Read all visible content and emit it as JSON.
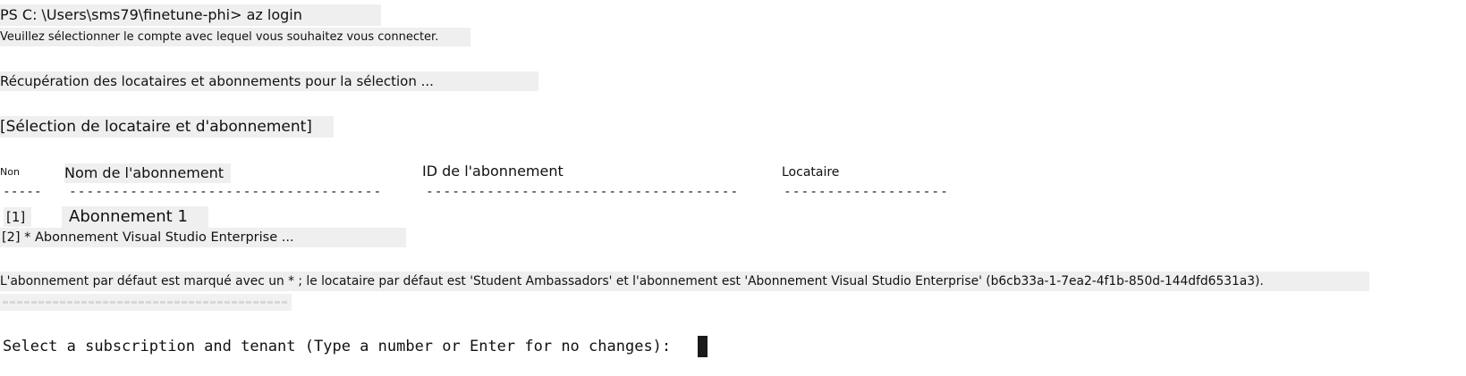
{
  "terminal": {
    "command_line": "PS C: \\Users\\sms79\\finetune-phi> az login",
    "select_account_msg": "Veuillez sélectionner le compte avec lequel vous souhaitez vous connecter.",
    "retrieving_msg": "Récupération des locataires et abonnements pour la sélection ...",
    "section_header": "[Sélection de locataire et d'abonnement]",
    "table": {
      "columns": [
        "Non",
        "Nom de l'abonnement",
        "ID de l'abonnement",
        "Locataire"
      ],
      "separators": [
        "-----",
        "------------------------------------",
        "------------------------------------",
        "-------------------"
      ],
      "rows": [
        {
          "number": "[1]",
          "name": "Abonnement 1"
        },
        {
          "line": "[2] * Abonnement Visual Studio Enterprise ..."
        }
      ]
    },
    "default_msg": "L'abonnement par défaut est marqué avec un * ; le locataire par défaut est 'Student Ambassadors' et l'abonnement est 'Abonnement Visual Studio Enterprise' (b6cb33a-1-7ea2-4f1b-850d-144dfd6531a3).",
    "prompt": "Select a subscription and tenant (Type a number or Enter for no changes):"
  }
}
